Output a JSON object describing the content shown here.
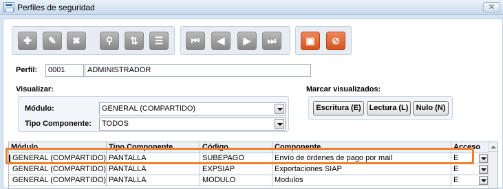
{
  "window": {
    "title": "Perfiles de seguridad",
    "close_symbol": "✕"
  },
  "toolbar": {
    "buttons": [
      {
        "name": "add",
        "glyph": "✚"
      },
      {
        "name": "edit",
        "glyph": "✎"
      },
      {
        "name": "delete",
        "glyph": "✖"
      },
      {
        "name": "search",
        "glyph": "⚲"
      },
      {
        "name": "sort",
        "glyph": "⇅"
      },
      {
        "name": "report",
        "glyph": "☰"
      },
      {
        "name": "first",
        "glyph": "⏮"
      },
      {
        "name": "previous",
        "glyph": "◀"
      },
      {
        "name": "next",
        "glyph": "▶"
      },
      {
        "name": "last",
        "glyph": "⏭"
      },
      {
        "name": "save",
        "glyph": "▣"
      },
      {
        "name": "cancel",
        "glyph": "⊘"
      }
    ]
  },
  "perfil": {
    "label": "Perfil:",
    "code": "0001",
    "name": "ADMINISTRADOR"
  },
  "visualizar": {
    "label": "Visualizar:",
    "modulo_label": "Módulo:",
    "modulo_value": "GENERAL (COMPARTIDO)",
    "tipo_label": "Tipo Componente:",
    "tipo_value": "TODOS"
  },
  "marcar": {
    "label": "Marcar visualizados:",
    "escritura": "Escritura (E)",
    "lectura": "Lectura (L)",
    "nulo": "Nulo (N)"
  },
  "grid": {
    "headers": [
      "Módulo",
      "Tipo Componente",
      "Código",
      "Componente",
      "Acceso"
    ],
    "rows": [
      [
        "GENERAL (COMPARTIDO)",
        "PANTALLA",
        "SUBEPAGO",
        "Envío de órdenes de pago por mail",
        "E"
      ],
      [
        "GENERAL (COMPARTIDO)",
        "PANTALLA",
        "EXPSIAP",
        "Exportaciones SIAP",
        "E"
      ],
      [
        "GENERAL (COMPARTIDO)",
        "PANTALLA",
        "MODULO",
        "Modulos",
        "E"
      ]
    ]
  },
  "colors": {
    "highlight": "#f07f2a",
    "action_orange": "#d2541f"
  }
}
